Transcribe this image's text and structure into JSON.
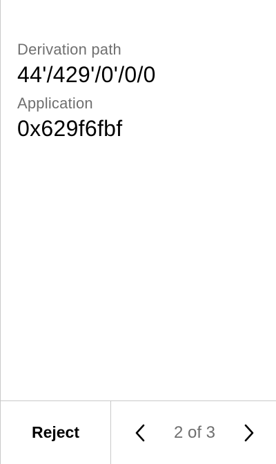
{
  "fields": [
    {
      "label": "Derivation path",
      "value": "44'/429'/0'/0/0"
    },
    {
      "label": "Application",
      "value": "0x629f6fbf"
    }
  ],
  "footer": {
    "reject_label": "Reject",
    "page_indicator": "2 of 3",
    "prev_icon": "chevron-left-icon",
    "next_icon": "chevron-right-icon"
  }
}
